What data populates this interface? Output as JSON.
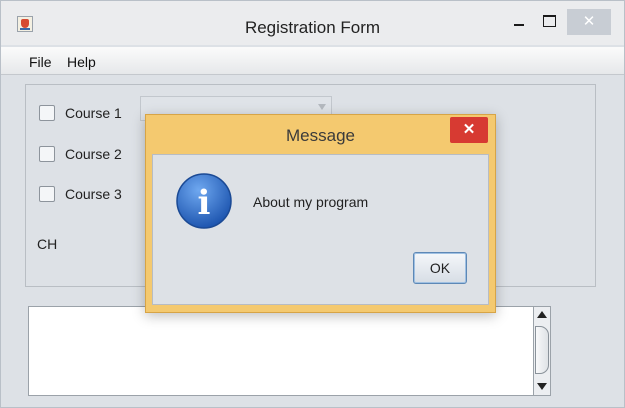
{
  "window": {
    "title": "Registration Form",
    "close_glyph": "✕"
  },
  "menu": {
    "file": "File",
    "help": "Help"
  },
  "form": {
    "courses": [
      {
        "label": "Course 1",
        "checked": false
      },
      {
        "label": "Course 2",
        "checked": false
      },
      {
        "label": "Course 3",
        "checked": false
      }
    ],
    "ch_label": "CH"
  },
  "dialog": {
    "title": "Message",
    "close_glyph": "✕",
    "icon_glyph": "i",
    "message": "About my program",
    "ok_label": "OK"
  },
  "colors": {
    "dialog_frame": "#f4c96f",
    "dialog_close": "#d73a32",
    "info_icon": "#2f6fc6"
  }
}
